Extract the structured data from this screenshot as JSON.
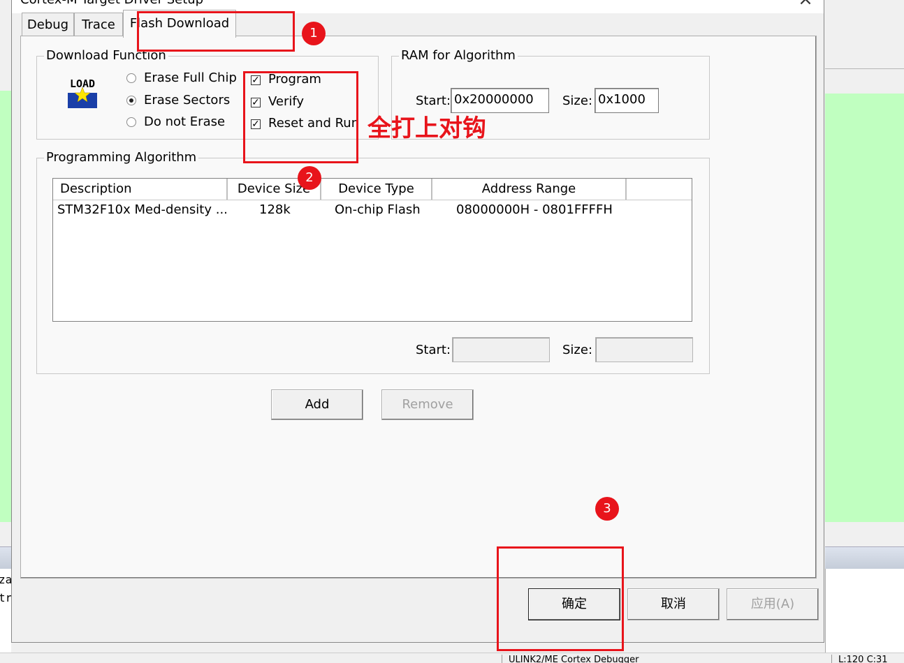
{
  "background": {
    "output_lines": [
      "za",
      "tr"
    ],
    "status_items": [
      "ULINK2/ME Cortex Debugger",
      "L:120 C:31"
    ],
    "colors": {
      "editor_bg": "#c0ffc0"
    }
  },
  "dialog": {
    "title": "Cortex-M Target Driver Setup",
    "close_icon": "×",
    "tabs": [
      {
        "label": "Debug",
        "active": false
      },
      {
        "label": "Trace",
        "active": false
      },
      {
        "label": "Flash Download",
        "active": true
      }
    ],
    "download_function": {
      "title": "Download Function",
      "icon": "load-icon",
      "icon_text": "LOAD",
      "radios": [
        {
          "label": "Erase Full Chip",
          "checked": false
        },
        {
          "label": "Erase Sectors",
          "checked": true
        },
        {
          "label": "Do not Erase",
          "checked": false
        }
      ],
      "checkboxes": [
        {
          "label": "Program",
          "checked": true
        },
        {
          "label": "Verify",
          "checked": true
        },
        {
          "label": "Reset and Run",
          "checked": true
        }
      ]
    },
    "ram_for_algorithm": {
      "title": "RAM for Algorithm",
      "start_label": "Start:",
      "start_value": "0x20000000",
      "size_label": "Size:",
      "size_value": "0x1000"
    },
    "programming_algorithm": {
      "title": "Programming Algorithm",
      "columns": [
        "Description",
        "Device Size",
        "Device Type",
        "Address Range"
      ],
      "rows": [
        [
          "STM32F10x Med-density ...",
          "128k",
          "On-chip Flash",
          "08000000H - 0801FFFFH"
        ]
      ],
      "start_label": "Start:",
      "start_value": "",
      "size_label": "Size:",
      "size_value": ""
    },
    "buttons": {
      "add": "Add",
      "remove": "Remove",
      "ok": "确定",
      "cancel": "取消",
      "apply": "应用(A)"
    }
  },
  "annotations": {
    "note": "全打上对钩",
    "markers": [
      "1",
      "2",
      "3"
    ],
    "color": "#e8141b"
  }
}
